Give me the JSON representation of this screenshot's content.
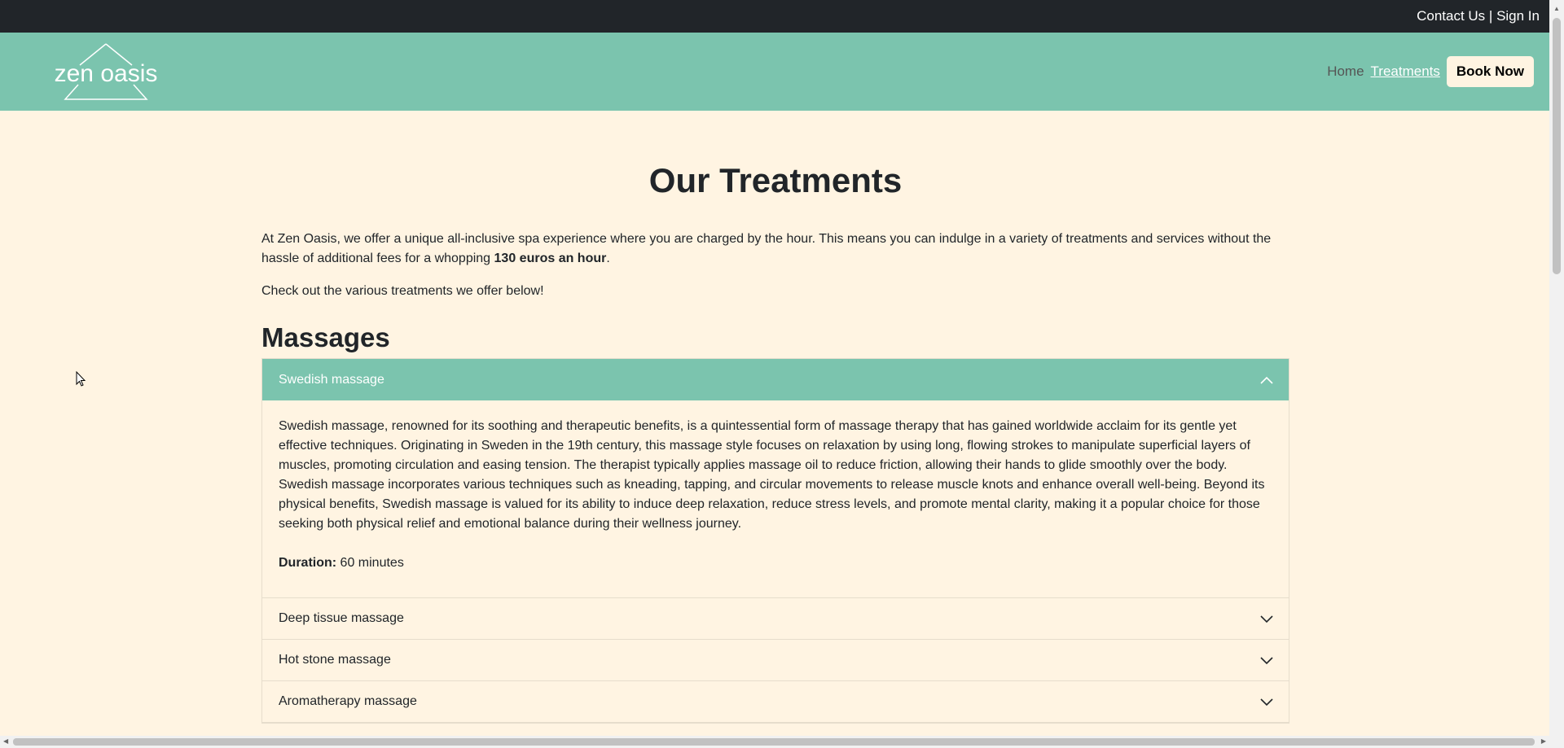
{
  "topbar": {
    "contact": "Contact Us",
    "separator": " | ",
    "signin": "Sign In"
  },
  "brand": {
    "logo_text": "zen oasis",
    "color": "#7bc4ae"
  },
  "nav": {
    "home": "Home",
    "treatments": "Treatments",
    "book": "Book Now"
  },
  "page": {
    "title": "Our Treatments",
    "intro_before": "At Zen Oasis, we offer a unique all-inclusive spa experience where you are charged by the hour. This means you can indulge in a variety of treatments and services without the hassle of additional fees for a whopping ",
    "intro_bold": "130 euros an hour",
    "intro_after": ".",
    "intro2": "Check out the various treatments we offer below!",
    "section_title": "Massages"
  },
  "accordion": {
    "open_item": {
      "title": "Swedish massage",
      "description": "Swedish massage, renowned for its soothing and therapeutic benefits, is a quintessential form of massage therapy that has gained worldwide acclaim for its gentle yet effective techniques. Originating in Sweden in the 19th century, this massage style focuses on relaxation by using long, flowing strokes to manipulate superficial layers of muscles, promoting circulation and easing tension. The therapist typically applies massage oil to reduce friction, allowing their hands to glide smoothly over the body. Swedish massage incorporates various techniques such as kneading, tapping, and circular movements to release muscle knots and enhance overall well-being. Beyond its physical benefits, Swedish massage is valued for its ability to induce deep relaxation, reduce stress levels, and promote mental clarity, making it a popular choice for those seeking both physical relief and emotional balance during their wellness journey.",
      "duration_label": "Duration:",
      "duration_value": " 60 minutes"
    },
    "items": [
      {
        "title": "Deep tissue massage"
      },
      {
        "title": "Hot stone massage"
      },
      {
        "title": "Aromatherapy massage"
      }
    ]
  }
}
